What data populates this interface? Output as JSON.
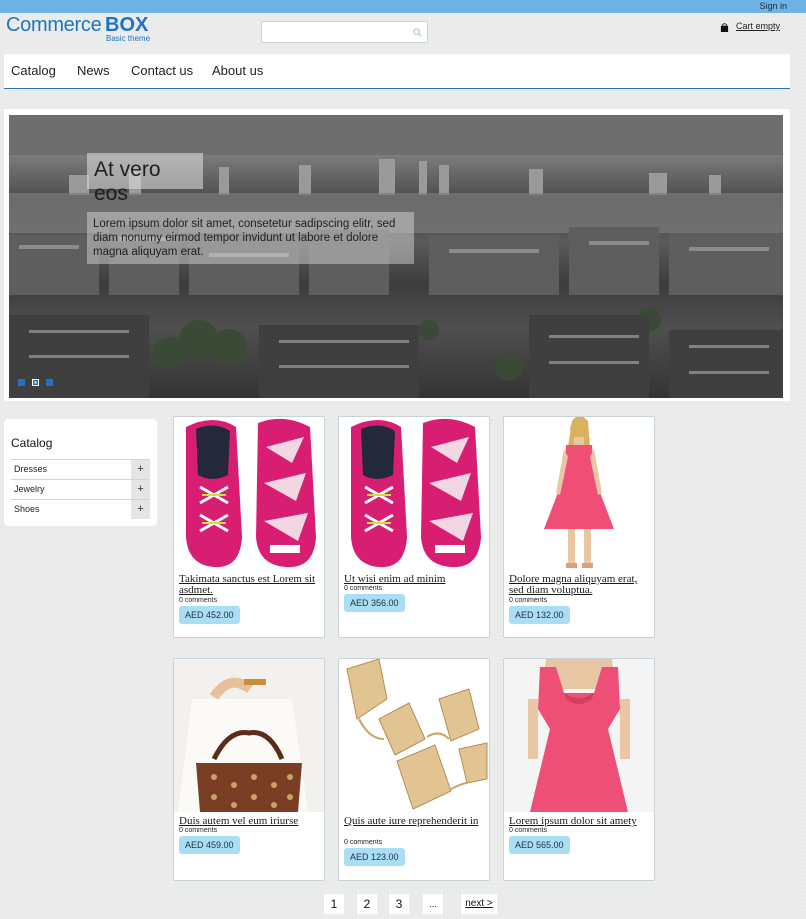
{
  "header": {
    "signin": "Sign in",
    "logo_part1": "Commerce",
    "logo_part2": "BOX",
    "logo_sub": "Basic theme",
    "search_placeholder": "",
    "cart_label": "Cart empty"
  },
  "nav": {
    "items": [
      "Catalog",
      "News",
      "Contact us",
      "About us"
    ]
  },
  "slider": {
    "title": "At vero eos",
    "text": "Lorem ipsum dolor sit amet, consetetur sadipscing elitr, sed diam nonumy eirmod tempor invidunt ut labore et dolore magna aliquyam erat.",
    "active_slide": 2,
    "slide_count": 3
  },
  "sidebar": {
    "title": "Catalog",
    "categories": [
      "Dresses",
      "Jewelry",
      "Shoes"
    ],
    "expand": "+"
  },
  "products": [
    {
      "title": "Takimata sanctus est Lorem sit asdmet.",
      "comments": "0 comments",
      "price": "AED 452.00",
      "image": "sneaker-icon"
    },
    {
      "title": "Ut wisi enim ad minim",
      "comments": "0 comments",
      "price": "AED 356.00",
      "image": "sneaker-icon"
    },
    {
      "title": "Dolore magna aliquyam erat, sed diam voluptua.",
      "comments": "0 comments",
      "price": "AED 132.00",
      "image": "dress-icon"
    },
    {
      "title": "Duis autem vel eum iriurse",
      "comments": "0 comments",
      "price": "AED 459.00",
      "image": "handbag-icon"
    },
    {
      "title": "Quis aute iure reprehenderit in",
      "comments": "0 comments",
      "price": "AED 123.00",
      "image": "necklace-icon"
    },
    {
      "title": "Lorem ipsum dolor sit amety",
      "comments": "0 comments",
      "price": "AED 565.00",
      "image": "dress-icon"
    }
  ],
  "pagination": {
    "pages": [
      "1",
      "2",
      "3"
    ],
    "ellipsis": "...",
    "next": "next >"
  },
  "colors": {
    "topbar": "#6fb3e6",
    "brand": "#1d74c6",
    "price_badge": "#a9def4",
    "nav_underline": "#2f72b4"
  }
}
